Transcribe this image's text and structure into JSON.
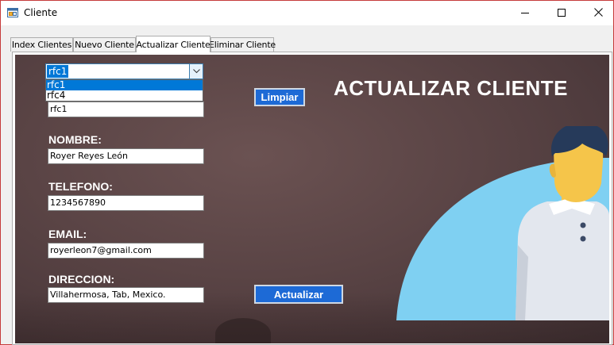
{
  "window": {
    "title": "Cliente",
    "icon": "app-form-icon",
    "controls": {
      "minimize": "minimize-icon",
      "maximize": "maximize-icon",
      "close": "close-icon"
    }
  },
  "tabs": [
    {
      "label": "Index Clientes",
      "active": false
    },
    {
      "label": "Nuevo Cliente",
      "active": false
    },
    {
      "label": "Actualizar Cliente",
      "active": true
    },
    {
      "label": "Eliminar Cliente",
      "active": false
    }
  ],
  "form": {
    "heading": "ACTUALIZAR CLIENTE",
    "rfc_select": {
      "value": "rfc1",
      "options": [
        "rfc1",
        "rfc4"
      ],
      "highlighted": "rfc1"
    },
    "rfc_value": "rfc1",
    "fields": [
      {
        "label": "NOMBRE:",
        "value": "Royer Reyes León"
      },
      {
        "label": "TELEFONO:",
        "value": "1234567890"
      },
      {
        "label": "EMAIL:",
        "value": "royerleon7@gmail.com"
      },
      {
        "label": "DIRECCION:",
        "value": "Villahermosa, Tab, Mexico."
      }
    ],
    "buttons": {
      "clear": "Limpiar",
      "update": "Actualizar"
    }
  },
  "colors": {
    "accent": "#1d6ad6",
    "selection": "#0078d7",
    "panel_background": "#5a4445",
    "illustration_circle": "#7fd0f2"
  }
}
